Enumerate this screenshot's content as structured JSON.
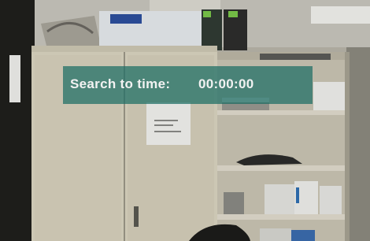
{
  "seek_overlay": {
    "label": "Search to time:",
    "time": "00:00:00"
  }
}
